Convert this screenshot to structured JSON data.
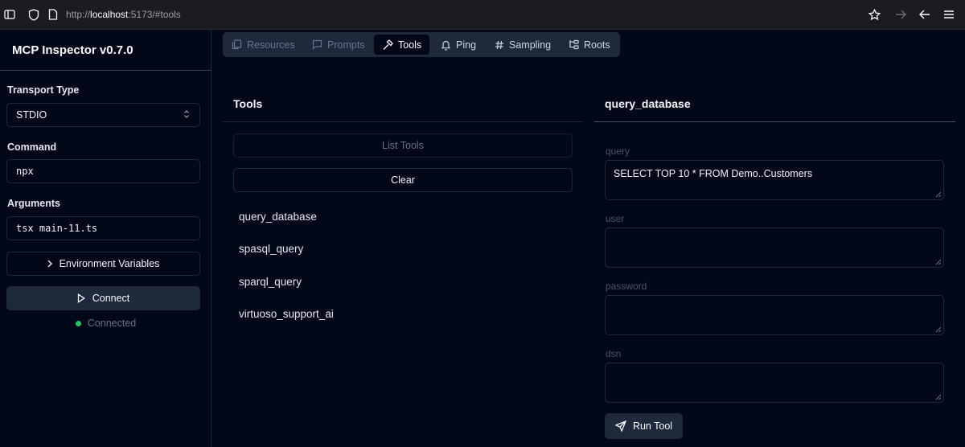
{
  "browser": {
    "url_scheme": "http://",
    "url_host": "localhost",
    "url_rest": ":5173/#tools"
  },
  "sidebar": {
    "app_title": "MCP Inspector v0.7.0",
    "transport_label": "Transport Type",
    "transport_value": "STDIO",
    "command_label": "Command",
    "command_value": "npx",
    "arguments_label": "Arguments",
    "arguments_value": "tsx main-11.ts",
    "env_button": "Environment Variables",
    "connect_button": "Connect",
    "status_text": "Connected",
    "status_color": "#22c55e"
  },
  "tabs": [
    {
      "label": "Resources",
      "icon": "files-icon",
      "state": "disabled"
    },
    {
      "label": "Prompts",
      "icon": "message-icon",
      "state": "disabled"
    },
    {
      "label": "Tools",
      "icon": "hammer-icon",
      "state": "active"
    },
    {
      "label": "Ping",
      "icon": "bell-icon",
      "state": "normal"
    },
    {
      "label": "Sampling",
      "icon": "hash-icon",
      "state": "normal"
    },
    {
      "label": "Roots",
      "icon": "folder-tree-icon",
      "state": "normal"
    }
  ],
  "tools_panel": {
    "title": "Tools",
    "list_button": "List Tools",
    "clear_button": "Clear",
    "items": [
      "query_database",
      "spasql_query",
      "sparql_query",
      "virtuoso_support_ai"
    ]
  },
  "tool_form": {
    "title": "query_database",
    "fields": [
      {
        "label": "query",
        "value": "SELECT TOP 10 * FROM Demo..Customers"
      },
      {
        "label": "user",
        "value": ""
      },
      {
        "label": "password",
        "value": ""
      },
      {
        "label": "dsn",
        "value": ""
      }
    ],
    "run_button": "Run Tool"
  }
}
